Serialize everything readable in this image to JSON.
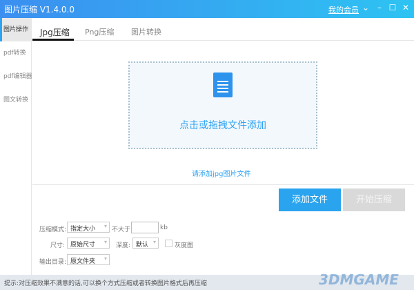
{
  "window": {
    "title": "图片压缩 V1.4.0.0",
    "member": "我的会员",
    "dropdown": "⌄",
    "minimize": "–",
    "maximize": "☐",
    "close": "✕"
  },
  "sidebar": {
    "items": [
      {
        "label": "图片操作"
      },
      {
        "label": "pdf转换"
      },
      {
        "label": "pdf编辑器"
      },
      {
        "label": "图文转换"
      }
    ]
  },
  "tabs": [
    {
      "label": "Jpg压缩"
    },
    {
      "label": "Png压缩"
    },
    {
      "label": "图片转换"
    }
  ],
  "dropzone": {
    "text": "点击或拖拽文件添加",
    "hint": "请添加jpg图片文件"
  },
  "buttons": {
    "add": "添加文件",
    "start": "开始压缩"
  },
  "options": {
    "mode_label": "压缩模式:",
    "mode_value": "指定大小",
    "max_label": "不大于",
    "max_value": "",
    "unit": "kb",
    "size_label": "尺寸:",
    "size_value": "原始尺寸",
    "depth_label": "深度:",
    "depth_value": "默认",
    "gray_label": "灰度图",
    "gray_checked": false,
    "output_label": "输出目录:",
    "output_value": "原文件夹"
  },
  "status": "提示:对压缩效果不满意的话,可以换个方式压缩或者转换图片格式后再压缩",
  "watermark": "3DMGAME"
}
